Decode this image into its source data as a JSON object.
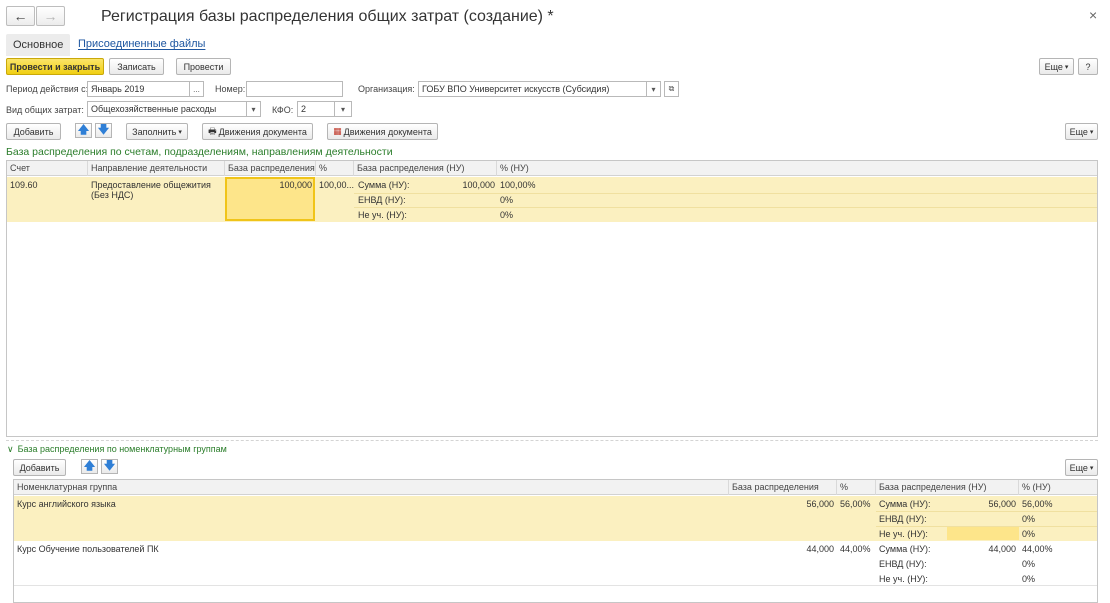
{
  "window": {
    "title": "Регистрация базы распределения общих затрат (создание) *",
    "back_glyph": "←",
    "forward_glyph": "→",
    "close_glyph": "×"
  },
  "tabs": {
    "main": "Основное",
    "files": "Присоединенные файлы"
  },
  "toolbar": {
    "post_close": "Провести и закрыть",
    "save": "Записать",
    "post": "Провести",
    "more": "Еще",
    "help": "?"
  },
  "form": {
    "period_label": "Период действия с:",
    "period_value": "Январь 2019",
    "period_btn": "...",
    "number_label": "Номер:",
    "number_value": "",
    "org_label": "Организация:",
    "org_value": "ГОБУ ВПО Университет искусств (Субсидия)",
    "cost_type_label": "Вид общих затрат:",
    "cost_type_value": "Общехозяйственные расходы",
    "kfo_label": "КФО:",
    "kfo_value": "2"
  },
  "table_toolbar": {
    "add": "Добавить",
    "fill": "Заполнить",
    "movements1": "Движения документа",
    "movements2": "Движения документа",
    "more": "Еще"
  },
  "section1": {
    "title": "База распределения по счетам, подразделениям, направлениям деятельности",
    "columns": {
      "account": "Счет",
      "direction": "Направление деятельности",
      "base": "База распределения",
      "pct": "%",
      "base_nu": "База распределения (НУ)",
      "pct_nu": "% (НУ)"
    },
    "rows": [
      {
        "account": "109.60",
        "direction_line1": "Предоставление общежития",
        "direction_line2": "(Без НДС)",
        "base": "100,000",
        "pct": "100,00...",
        "nu": [
          {
            "label": "Сумма (НУ):",
            "value": "100,000",
            "pct": "100,00%"
          },
          {
            "label": "ЕНВД (НУ):",
            "value": "",
            "pct": "0%"
          },
          {
            "label": "Не уч. (НУ):",
            "value": "",
            "pct": "0%"
          }
        ]
      }
    ]
  },
  "section2": {
    "title": "База распределения по номенклатурным группам",
    "add": "Добавить",
    "more": "Еще",
    "columns": {
      "group": "Номенклатурная группа",
      "base": "База распределения",
      "pct": "%",
      "base_nu": "База распределения (НУ)",
      "pct_nu": "% (НУ)"
    },
    "rows": [
      {
        "group": "Курс английского языка",
        "base": "56,000",
        "pct": "56,00%",
        "nu": [
          {
            "label": "Сумма (НУ):",
            "value": "56,000",
            "pct": "56,00%"
          },
          {
            "label": "ЕНВД (НУ):",
            "value": "",
            "pct": "0%"
          },
          {
            "label": "Не уч. (НУ):",
            "value": "",
            "pct": "0%"
          }
        ]
      },
      {
        "group": "Курс Обучение пользователей ПК",
        "base": "44,000",
        "pct": "44,00%",
        "nu": [
          {
            "label": "Сумма (НУ):",
            "value": "44,000",
            "pct": "44,00%"
          },
          {
            "label": "ЕНВД (НУ):",
            "value": "",
            "pct": "0%"
          },
          {
            "label": "Не уч. (НУ):",
            "value": "",
            "pct": "0%"
          }
        ]
      }
    ]
  },
  "colors": {
    "accent_yellow": "#f5d820",
    "selected_row": "#fbf0c0",
    "section_green": "#2a7d2a",
    "link_blue": "#1e56a0"
  }
}
